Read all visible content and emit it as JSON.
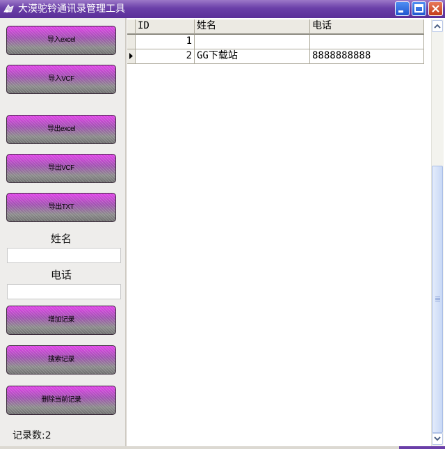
{
  "window": {
    "title": "大漠驼铃通讯录管理工具",
    "colors": {
      "titlebar": "#6a3fa8",
      "button_top": "#e040e8",
      "button_bottom": "#6e6e6e"
    }
  },
  "sidebar": {
    "buttons": {
      "import_excel": "导入excel",
      "import_vcf": "导入VCF",
      "export_excel": "导出excel",
      "export_vcf": "导出VCF",
      "export_txt": "导出TXT",
      "add_record": "增加记录",
      "search_record": "搜索记录",
      "delete_record": "删除当前记录"
    },
    "name_label": "姓名",
    "name_value": "",
    "phone_label": "电话",
    "phone_value": "",
    "record_count": "记录数:2"
  },
  "table": {
    "columns": [
      "ID",
      "姓名",
      "电话"
    ],
    "rows": [
      {
        "id": "1",
        "name": "",
        "phone": ""
      },
      {
        "id": "2",
        "name": "GG下载站",
        "phone": "8888888888",
        "current": true
      }
    ]
  },
  "icons": [
    "app-icon",
    "minimize-icon",
    "maximize-icon",
    "close-icon",
    "row-pointer-icon",
    "scroll-up-icon",
    "scroll-down-icon"
  ]
}
